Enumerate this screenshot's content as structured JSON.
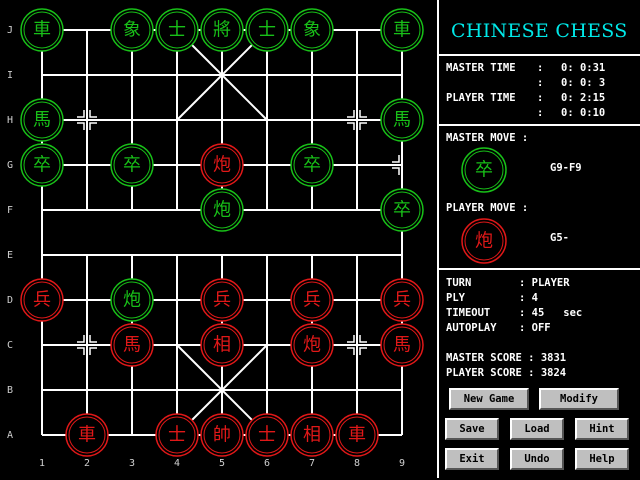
{
  "app": {
    "title": "CHINESE CHESS",
    "colors": {
      "board_line": "#ffffff",
      "red": "#e01818",
      "green": "#18c018",
      "accent": "#00e8e8",
      "button": "#bfbfbf"
    }
  },
  "board": {
    "rank_labels": [
      "J",
      "I",
      "H",
      "G",
      "F",
      "E",
      "D",
      "C",
      "B",
      "A"
    ],
    "file_labels": [
      "1",
      "2",
      "3",
      "4",
      "5",
      "6",
      "7",
      "8",
      "9"
    ],
    "pieces": [
      {
        "file": 1,
        "rank": "J",
        "char": "車",
        "color": "green"
      },
      {
        "file": 3,
        "rank": "J",
        "char": "象",
        "color": "green"
      },
      {
        "file": 4,
        "rank": "J",
        "char": "士",
        "color": "green"
      },
      {
        "file": 5,
        "rank": "J",
        "char": "將",
        "color": "green"
      },
      {
        "file": 6,
        "rank": "J",
        "char": "士",
        "color": "green"
      },
      {
        "file": 7,
        "rank": "J",
        "char": "象",
        "color": "green"
      },
      {
        "file": 9,
        "rank": "J",
        "char": "車",
        "color": "green"
      },
      {
        "file": 1,
        "rank": "H",
        "char": "馬",
        "color": "green"
      },
      {
        "file": 9,
        "rank": "H",
        "char": "馬",
        "color": "green"
      },
      {
        "file": 1,
        "rank": "G",
        "char": "卒",
        "color": "green"
      },
      {
        "file": 3,
        "rank": "G",
        "char": "卒",
        "color": "green"
      },
      {
        "file": 5,
        "rank": "G",
        "char": "炮",
        "color": "red"
      },
      {
        "file": 7,
        "rank": "G",
        "char": "卒",
        "color": "green"
      },
      {
        "file": 5,
        "rank": "F",
        "char": "炮",
        "color": "green"
      },
      {
        "file": 9,
        "rank": "F",
        "char": "卒",
        "color": "green"
      },
      {
        "file": 1,
        "rank": "D",
        "char": "兵",
        "color": "red"
      },
      {
        "file": 3,
        "rank": "D",
        "char": "炮",
        "color": "green"
      },
      {
        "file": 5,
        "rank": "D",
        "char": "兵",
        "color": "red"
      },
      {
        "file": 7,
        "rank": "D",
        "char": "兵",
        "color": "red"
      },
      {
        "file": 9,
        "rank": "D",
        "char": "兵",
        "color": "red"
      },
      {
        "file": 3,
        "rank": "C",
        "char": "馬",
        "color": "red"
      },
      {
        "file": 5,
        "rank": "C",
        "char": "相",
        "color": "red"
      },
      {
        "file": 7,
        "rank": "C",
        "char": "炮",
        "color": "red"
      },
      {
        "file": 9,
        "rank": "C",
        "char": "馬",
        "color": "red"
      },
      {
        "file": 2,
        "rank": "A",
        "char": "車",
        "color": "red"
      },
      {
        "file": 4,
        "rank": "A",
        "char": "士",
        "color": "red"
      },
      {
        "file": 5,
        "rank": "A",
        "char": "帥",
        "color": "red"
      },
      {
        "file": 6,
        "rank": "A",
        "char": "士",
        "color": "red"
      },
      {
        "file": 7,
        "rank": "A",
        "char": "相",
        "color": "red"
      },
      {
        "file": 8,
        "rank": "A",
        "char": "車",
        "color": "red"
      }
    ],
    "position_marks": [
      {
        "file": 2,
        "rank": "H"
      },
      {
        "file": 8,
        "rank": "H"
      },
      {
        "file": 2,
        "rank": "C"
      },
      {
        "file": 8,
        "rank": "C"
      }
    ],
    "edge_mark": {
      "file": 9,
      "rank": "G"
    }
  },
  "panel": {
    "times": {
      "master_label": "MASTER TIME",
      "master_1": "0: 0:31",
      "master_2": "0: 0: 3",
      "player_label": "PLAYER TIME",
      "player_1": "0: 2:15",
      "player_2": "0: 0:10",
      "sep": ":"
    },
    "master_move": {
      "label": "MASTER MOVE :",
      "char": "卒",
      "color": "green",
      "text": "G9-F9"
    },
    "player_move": {
      "label": "PLAYER MOVE :",
      "char": "炮",
      "color": "red",
      "text": "G5-"
    },
    "status": {
      "turn_label": "TURN",
      "turn_value": ": PLAYER",
      "ply_label": "PLY",
      "ply_value": ": 4",
      "timeout_label": "TIMEOUT",
      "timeout_value": ": 45   sec",
      "autoplay_label": "AUTOPLAY",
      "autoplay_value": ": OFF"
    },
    "scores": {
      "master": "MASTER SCORE : 3831",
      "player": "PLAYER SCORE : 3824"
    },
    "buttons": {
      "new_game": "New Game",
      "modify": "Modify",
      "save": "Save",
      "load": "Load",
      "hint": "Hint",
      "exit": "Exit",
      "undo": "Undo",
      "help": "Help"
    }
  }
}
